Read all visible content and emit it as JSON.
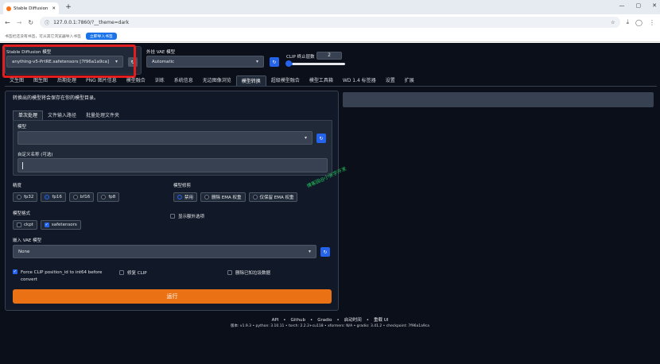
{
  "browser": {
    "tab_title": "Stable Diffusion",
    "new_tab": "+",
    "url": "127.0.0.1:7860/?__theme=dark",
    "bookmark_hint": "书签栏还没有书签，可从其它浏览器导入书签",
    "bookmark_import": "立即导入书签"
  },
  "top": {
    "sd_model_label": "Stable Diffusion 模型",
    "sd_model_value": "anything-v5-PrtRE.safetensors [7f96a1a9ca]",
    "vae_label": "外挂 VAE 模型",
    "vae_value": "Automatic",
    "clip_label": "CLIP 终止层数",
    "clip_value": "2",
    "clip_fraction": 0.083
  },
  "tabs": [
    "文生图",
    "图生图",
    "后期处理",
    "PNG 图片信息",
    "模型融合",
    "训练",
    "系统信息",
    "无边图像浏览",
    "模型转换",
    "超级模型融合",
    "模型工具箱",
    "WD 1.4 标签器",
    "设置",
    "扩展"
  ],
  "active_tab": "模型转换",
  "convert": {
    "notice": "转换出的模型将会保存在你的模型目录。",
    "subtabs": [
      "单次处理",
      "文件输入路径",
      "批量处理文件夹"
    ],
    "model_label": "模型",
    "model_value": "",
    "custom_name_label": "自定义名称 (可选)",
    "custom_name_value": "",
    "precision_label": "精度",
    "precision_options": [
      "fp32",
      "fp16",
      "bf16",
      "fp8"
    ],
    "precision_selected": "fp16",
    "pruning_label": "模型修剪",
    "pruning_options": [
      "禁用",
      "删除 EMA 权重",
      "仅保留 EMA 权重"
    ],
    "pruning_selected": "禁用",
    "format_label": "模型格式",
    "format_options": [
      "ckpt",
      "safetensors"
    ],
    "format_selected": "safetensors",
    "show_extra_label": "显示额外选项",
    "vae_label": "嵌入 VAE 模型",
    "vae_value": "None",
    "force_clip_label": "Force CLIP position_id to int64 before convert",
    "fix_clip_label": "修复 CLIP",
    "delete_junk_label": "删除已知垃圾数据",
    "run_label": "运行"
  },
  "footer": {
    "links": [
      "API",
      "Github",
      "Gradio",
      "启动时间",
      "重载 UI"
    ],
    "separator": "•",
    "versions": "版本: v1.9.3  •  python: 3.10.11  •  torch: 2.2.2+cu118  •  xformers: N/A  •  gradio: 3.41.2  •  checkpoint: 7f96a1a9ca"
  },
  "watermark": "博客园@小张学开发",
  "colors": {
    "accent": "#2563eb",
    "run": "#ea7114",
    "highlight": "#e11d1d"
  }
}
